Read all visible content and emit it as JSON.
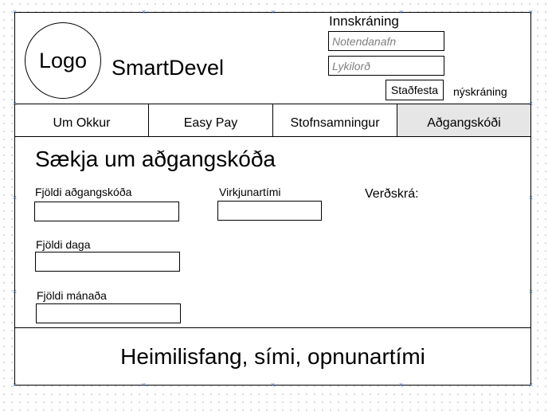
{
  "header": {
    "logo_text": "Logo",
    "brand_name": "SmartDevel"
  },
  "login": {
    "title": "Innskráning",
    "username_placeholder": "Notendanafn",
    "password_placeholder": "Lykilorð",
    "submit_label": "Staðfesta",
    "register_label": "nýskráning"
  },
  "nav": {
    "tabs": [
      {
        "label": "Um Okkur"
      },
      {
        "label": "Easy Pay"
      },
      {
        "label": "Stofnsamningur"
      },
      {
        "label": "Aðgangskóði"
      }
    ],
    "active_tab": "Aðgangskóði"
  },
  "main": {
    "title": "Sækja um aðgangskóða",
    "fields": {
      "access_code_count": {
        "label": "Fjöldi aðgangskóða",
        "value": ""
      },
      "activation_time": {
        "label": "Virkjunartími",
        "value": ""
      },
      "days_count": {
        "label": "Fjöldi daga",
        "value": ""
      },
      "months_count": {
        "label": "Fjöldi mánaða",
        "value": ""
      }
    },
    "price_list_label": "Verðskrá:"
  },
  "footer": {
    "text": "Heimilisfang, sími, opnunartími"
  },
  "colors": {
    "active_tab_bg": "#e6e6e6",
    "handle_color": "#4a6db5",
    "placeholder_color": "#808080"
  }
}
